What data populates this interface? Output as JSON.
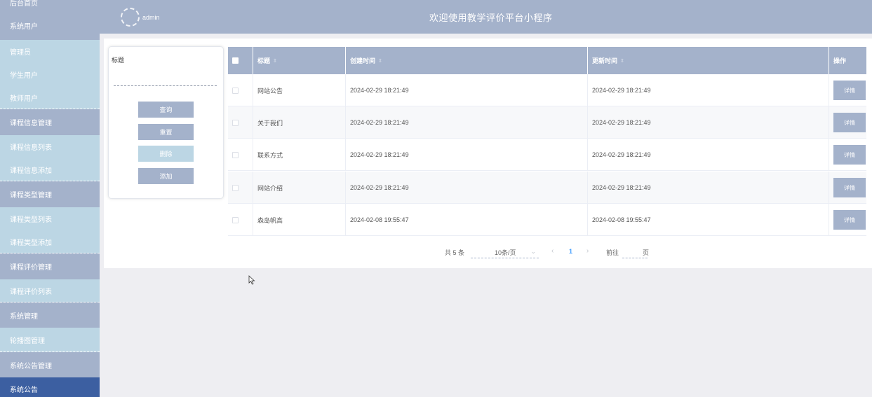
{
  "sidebar": {
    "items": [
      {
        "label": "后台首页"
      },
      {
        "label": "系统用户"
      },
      {
        "label": "管理员"
      },
      {
        "label": "学生用户"
      },
      {
        "label": "教师用户"
      },
      {
        "label": "课程信息管理"
      },
      {
        "label": "课程信息列表"
      },
      {
        "label": "课程信息添加"
      },
      {
        "label": "课程类型管理"
      },
      {
        "label": "课程类型列表"
      },
      {
        "label": "课程类型添加"
      },
      {
        "label": "课程评价管理"
      },
      {
        "label": "课程评价列表"
      },
      {
        "label": "系统管理"
      },
      {
        "label": "轮播图管理"
      },
      {
        "label": "系统公告管理"
      },
      {
        "label": "系统公告"
      }
    ]
  },
  "header": {
    "username": "admin",
    "title": "欢迎使用教学评价平台小程序",
    "logo_icon": "loading-spinner-icon"
  },
  "search": {
    "label": "标题",
    "value": "",
    "buttons": {
      "query": "查询",
      "reset": "重置",
      "delete": "删除",
      "add": "添加"
    }
  },
  "table": {
    "headers": {
      "title": "标题",
      "created": "创建时间",
      "updated": "更新时间",
      "actions": "操作"
    },
    "sort_icon": "⇳",
    "rows": [
      {
        "title": "网站公告",
        "created": "2024-02-29 18:21:49",
        "updated": "2024-02-29 18:21:49",
        "action": "详情"
      },
      {
        "title": "关于我们",
        "created": "2024-02-29 18:21:49",
        "updated": "2024-02-29 18:21:49",
        "action": "详情"
      },
      {
        "title": "联系方式",
        "created": "2024-02-29 18:21:49",
        "updated": "2024-02-29 18:21:49",
        "action": "详情"
      },
      {
        "title": "网站介绍",
        "created": "2024-02-29 18:21:49",
        "updated": "2024-02-29 18:21:49",
        "action": "详情"
      },
      {
        "title": "森岛帆高",
        "created": "2024-02-08 19:55:47",
        "updated": "2024-02-08 19:55:47",
        "action": "详情"
      }
    ]
  },
  "pagination": {
    "total": "共 5 条",
    "page_size": "10条/页",
    "prev": "‹",
    "current": "1",
    "next": "›",
    "goto": "前往",
    "page_unit": "页"
  },
  "colors": {
    "accent": "#a4b2cb",
    "light": "#bcd6e4",
    "active": "#3c5fa1"
  }
}
